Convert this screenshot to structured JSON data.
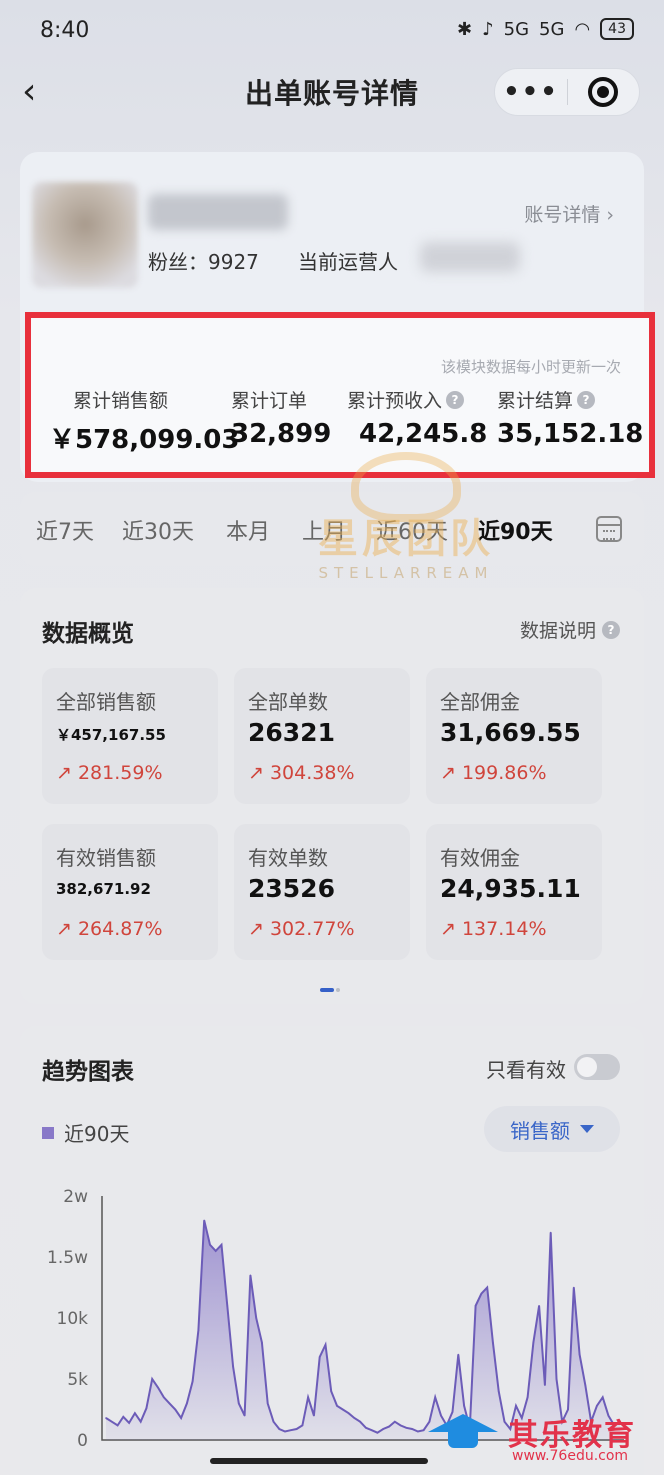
{
  "status": {
    "time": "8:40",
    "battery": "43",
    "network1": "5G",
    "network2": "5G"
  },
  "nav": {
    "title": "出单账号详情",
    "back": "‹",
    "more": "•••"
  },
  "account": {
    "detail_link": "账号详情 ›",
    "fans": "粉丝：9927",
    "operator": "当前运营人"
  },
  "summary": {
    "note": "该模块数据每小时更新一次",
    "stats": [
      {
        "label": "累计销售额",
        "value": "￥578,099.03",
        "help": false
      },
      {
        "label": "累计订单",
        "value": "32,899",
        "help": false
      },
      {
        "label": "累计预收入",
        "value": "42,245.8",
        "help": true
      },
      {
        "label": "累计结算",
        "value": "35,152.18",
        "help": true
      }
    ]
  },
  "tabs": {
    "items": [
      "近7天",
      "近30天",
      "本月",
      "上月",
      "近60天",
      "近90天"
    ],
    "active_index": 5
  },
  "watermark": {
    "title": "星辰团队",
    "sub": "STELLARREAM"
  },
  "overview": {
    "title": "数据概览",
    "help": "数据说明",
    "metrics": [
      {
        "label": "全部销售额",
        "value": "￥457,167.55",
        "change": "↗ 281.59%"
      },
      {
        "label": "全部单数",
        "value": "26321",
        "change": "↗ 304.38%"
      },
      {
        "label": "全部佣金",
        "value": "31,669.55",
        "change": "↗ 199.86%"
      },
      {
        "label": "有效销售额",
        "value": "382,671.92",
        "change": "↗ 264.87%"
      },
      {
        "label": "有效单数",
        "value": "23526",
        "change": "↗ 302.77%"
      },
      {
        "label": "有效佣金",
        "value": "24,935.11",
        "change": "↗ 137.14%"
      }
    ]
  },
  "trend": {
    "title": "趋势图表",
    "toggle_label": "只看有效",
    "legend": "近90天",
    "select": "销售额"
  },
  "colors": {
    "accent": "#3a66c8",
    "highlight": "#e8303c",
    "up": "#d0453c",
    "series": "#8878c8"
  },
  "chart_data": {
    "type": "area",
    "title": "",
    "xlabel": "",
    "ylabel": "",
    "y_ticks": [
      "0",
      "5k",
      "10k",
      "1.5w",
      "2w"
    ],
    "ylim": [
      0,
      20000
    ],
    "series": [
      {
        "name": "近90天",
        "values": [
          1800,
          1500,
          1200,
          1900,
          1400,
          2200,
          1500,
          2600,
          5000,
          4300,
          3500,
          3000,
          2500,
          1800,
          3000,
          4800,
          9000,
          18000,
          16000,
          15500,
          16000,
          11000,
          6000,
          3000,
          2000,
          13500,
          10000,
          8000,
          3000,
          1500,
          900,
          700,
          800,
          900,
          1200,
          3500,
          2000,
          6800,
          7800,
          4000,
          2800,
          2500,
          2200,
          1800,
          1500,
          1000,
          800,
          600,
          900,
          1100,
          1500,
          1200,
          1000,
          900,
          700,
          800,
          1500,
          3500,
          2000,
          1200,
          2300,
          7000,
          2800,
          1000,
          11000,
          12000,
          12500,
          8000,
          4000,
          1500,
          900,
          2800,
          1800,
          3500,
          8000,
          11000,
          4500,
          17000,
          5000,
          1500,
          2500,
          12500,
          7000,
          4500,
          1500,
          2800,
          3500,
          2000,
          1200,
          1500
        ]
      }
    ]
  },
  "brand": {
    "name": "其乐教育",
    "url": "www.76edu.com"
  }
}
